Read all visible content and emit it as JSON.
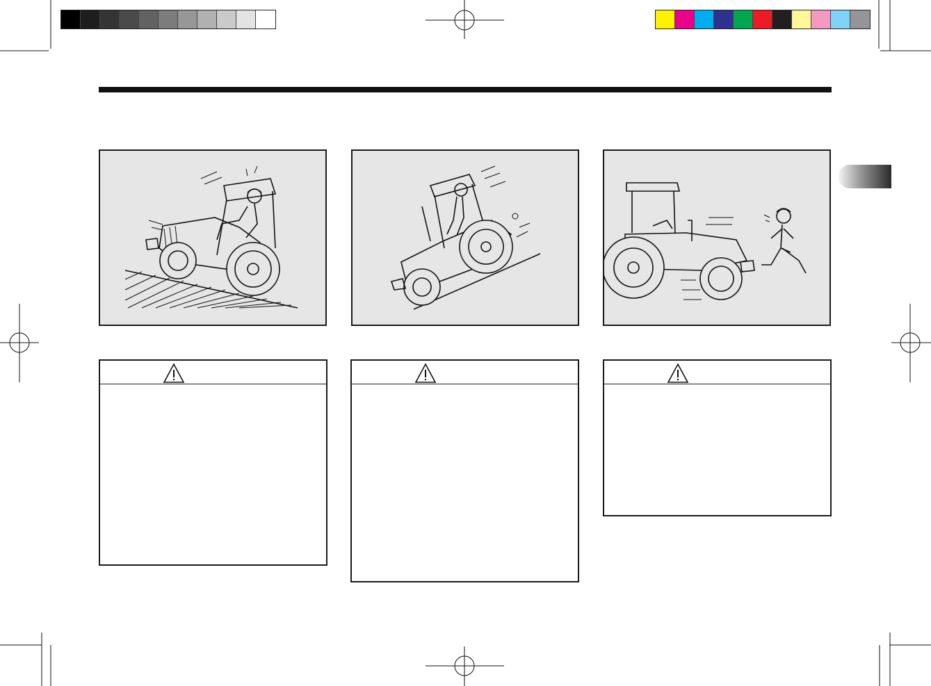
{
  "registration": {
    "gray_swatches": [
      "#000000",
      "#1e1e1e",
      "#343434",
      "#4a4a4a",
      "#626262",
      "#7c7c7c",
      "#979797",
      "#b1b1b1",
      "#cacaca",
      "#e3e3e3",
      "#ffffff"
    ],
    "color_swatches": [
      "#fff200",
      "#ec008c",
      "#00aeef",
      "#2e3192",
      "#00a651",
      "#ed1c24",
      "#231f20",
      "#fff799",
      "#f49ac1",
      "#7fd3f7",
      "#939598"
    ]
  },
  "figures": [
    {
      "scene": "tractor-climbing-slope",
      "icon": "tractor-uphill-illustration"
    },
    {
      "scene": "tractor-tipping-backward",
      "icon": "tractor-overturn-illustration"
    },
    {
      "scene": "tractor-runaway-person-fleeing",
      "icon": "tractor-runaway-illustration"
    }
  ],
  "warnings": [
    {
      "icon": "warning-triangle-icon"
    },
    {
      "icon": "warning-triangle-icon"
    },
    {
      "icon": "warning-triangle-icon"
    }
  ],
  "colors": {
    "rule": "#111111",
    "panel": "#e6e6e6",
    "border": "#1a1a1a"
  }
}
